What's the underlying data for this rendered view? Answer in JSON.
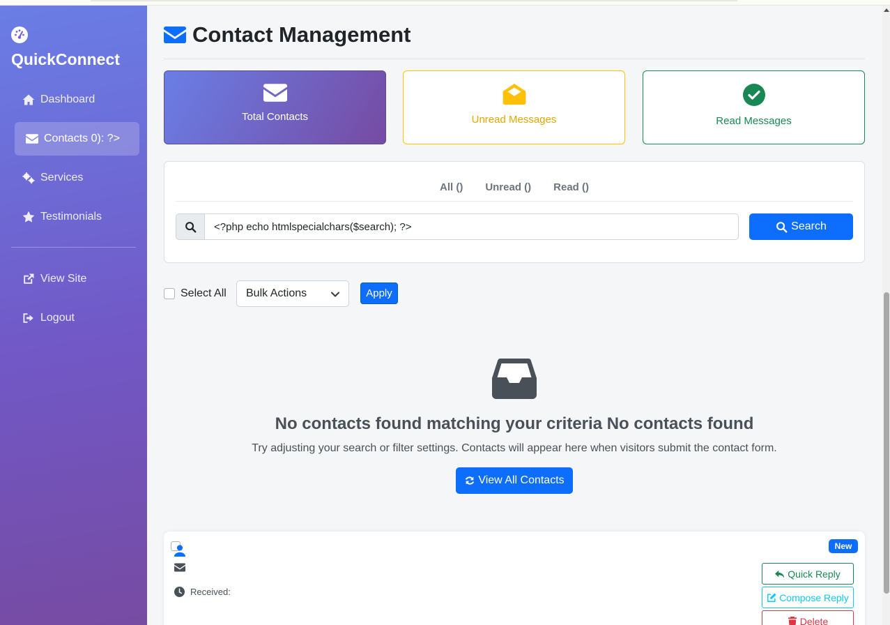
{
  "app": {
    "brand": "QuickConnect"
  },
  "sidebar": {
    "items": [
      {
        "label": "Dashboard",
        "icon": "home-icon"
      },
      {
        "label": "Contacts 0): ?>",
        "icon": "envelope-icon",
        "active": true
      },
      {
        "label": "Services",
        "icon": "gears-icon"
      },
      {
        "label": "Testimonials",
        "icon": "star-icon"
      },
      {
        "label": "View Site",
        "icon": "external-link-icon"
      },
      {
        "label": "Logout",
        "icon": "sign-out-icon"
      }
    ]
  },
  "page": {
    "title": "Contact Management"
  },
  "stats": {
    "total": {
      "label": "Total Contacts"
    },
    "unread": {
      "label": "Unread Messages"
    },
    "read": {
      "label": "Read Messages"
    }
  },
  "filters": {
    "tabs": [
      "All ()",
      "Unread ()",
      "Read ()"
    ],
    "search_value": "<?php echo htmlspecialchars($search); ?>",
    "search_button": "Search"
  },
  "bulk": {
    "select_all": "Select All",
    "selected_action": "Bulk Actions",
    "apply": "Apply"
  },
  "empty_state": {
    "heading": "No contacts found matching your criteria No contacts found",
    "message": "Try adjusting your search or filter settings. Contacts will appear here when visitors submit the contact form.",
    "button": "View All Contacts"
  },
  "contact_card": {
    "badge": "New",
    "received_label": "Received:",
    "actions": {
      "quick_reply": "Quick Reply",
      "compose_reply": "Compose Reply",
      "delete": "Delete"
    }
  },
  "colors": {
    "primary": "#0d6efd",
    "warning": "#ffc107",
    "success": "#198754",
    "info": "#0dcaf0",
    "danger": "#dc3545",
    "sidebar_gradient_start": "#6a7ee6",
    "sidebar_gradient_end": "#764ba2"
  }
}
